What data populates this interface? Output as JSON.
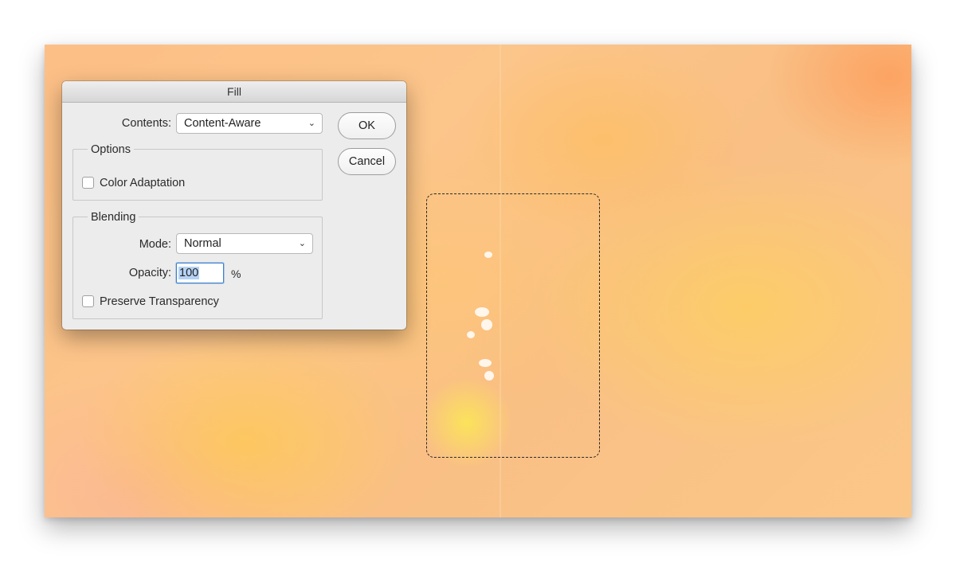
{
  "dialog": {
    "title": "Fill",
    "contents": {
      "label": "Contents:",
      "value": "Content-Aware"
    },
    "buttons": {
      "ok": "OK",
      "cancel": "Cancel"
    },
    "options": {
      "title": "Options",
      "color_adaptation": {
        "label": "Color Adaptation",
        "checked": false
      }
    },
    "blending": {
      "title": "Blending",
      "mode": {
        "label": "Mode:",
        "value": "Normal"
      },
      "opacity": {
        "label": "Opacity:",
        "value": "100",
        "unit": "%"
      },
      "preserve_transparency": {
        "label": "Preserve Transparency",
        "checked": false
      }
    }
  },
  "icons": {
    "dropdown": "chevron-down-icon"
  },
  "colors": {
    "dialog_bg": "#ececec",
    "focus_ring": "#3d7fcc",
    "text_selection": "#b5d3f5"
  }
}
